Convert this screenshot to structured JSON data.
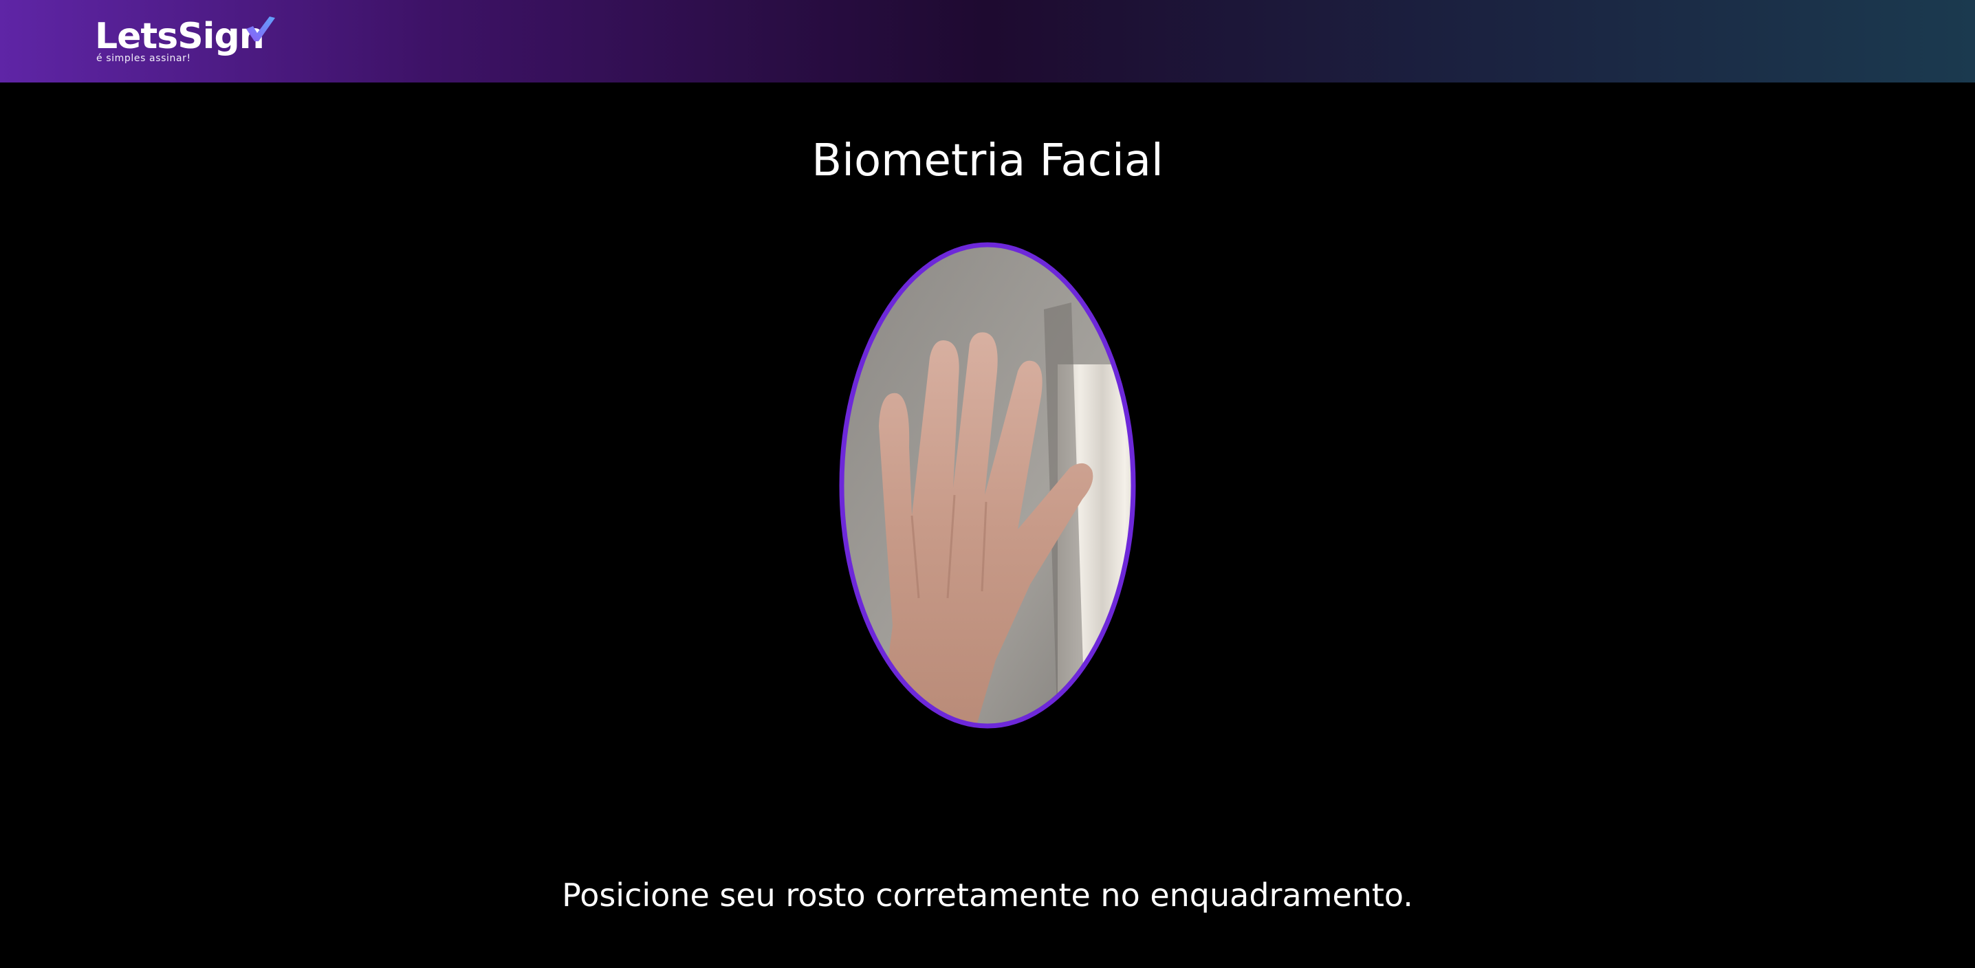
{
  "brand": {
    "name": "LetsSign",
    "tagline": "é simples assinar!",
    "check_colors": [
      "#8b5cf6",
      "#60a5fa"
    ]
  },
  "header": {
    "gradient_colors": [
      "#5f25a6",
      "#1e0a30",
      "#1b3a4f"
    ]
  },
  "page": {
    "title": "Biometria Facial",
    "instruction": "Posicione seu rosto corretamente no enquadramento."
  },
  "camera": {
    "frame_color": "#6d28d9",
    "frame_shape": "ellipse",
    "subject": "hand-raised"
  }
}
